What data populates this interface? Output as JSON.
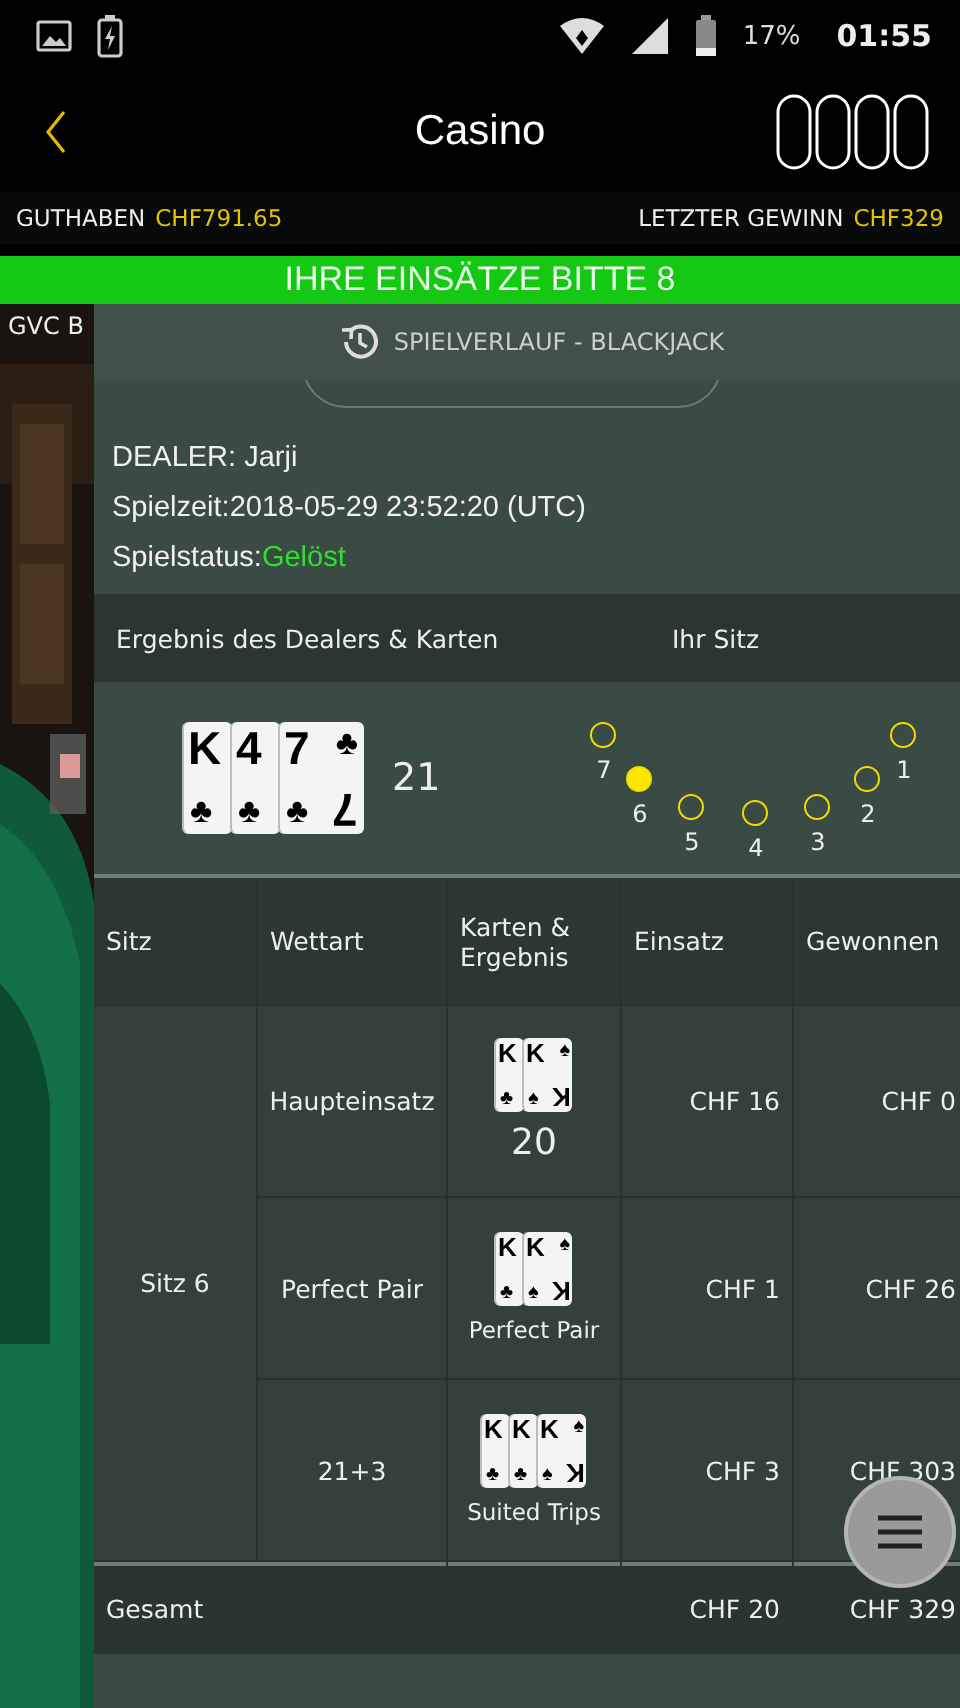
{
  "status_bar": {
    "battery_percent": "17%",
    "time": "01:55"
  },
  "header": {
    "title": "Casino"
  },
  "balance_bar": {
    "balance_label": "GUTHABEN",
    "balance_value": "CHF791.65",
    "last_win_label": "LETZTER GEWINN",
    "last_win_value": "CHF329"
  },
  "banner": {
    "text": "IHRE EINSÄTZE BITTE 8"
  },
  "background": {
    "table_label": "GVC B"
  },
  "history": {
    "title": "SPIELVERLAUF - BLACKJACK",
    "dealer": "DEALER: Jarji",
    "time": "Spielzeit:2018-05-29 23:52:20 (UTC)",
    "status_label": "Spielstatus:",
    "status_value": "Gelöst",
    "section_headers": [
      "Ergebnis des Dealers & Karten",
      "Ihr Sitz"
    ],
    "dealer_cards": [
      {
        "rank": "K",
        "suit": "♣"
      },
      {
        "rank": "4",
        "suit": "♣"
      },
      {
        "rank": "7",
        "suit": "♣",
        "corner_suit": "♣",
        "corner_rank": "7"
      }
    ],
    "dealer_total": "21",
    "seats": [
      {
        "label": "7",
        "selected": false
      },
      {
        "label": "6",
        "selected": true
      },
      {
        "label": "5",
        "selected": false
      },
      {
        "label": "4",
        "selected": false
      },
      {
        "label": "3",
        "selected": false
      },
      {
        "label": "2",
        "selected": false
      },
      {
        "label": "1",
        "selected": false
      }
    ]
  },
  "table": {
    "columns": [
      "Sitz",
      "Wettart",
      "Karten & Ergebnis",
      "Einsatz",
      "Gewonnen"
    ],
    "seat": "Sitz 6",
    "rows": [
      {
        "bet_type": "Haupteinsatz",
        "cards": [
          {
            "rank": "K",
            "suit": "♣"
          },
          {
            "rank": "K",
            "suit": "♠",
            "corner_suit": "♠",
            "corner_rank": "K"
          }
        ],
        "hand_total": "20",
        "stake": "CHF 16",
        "won": "CHF 0"
      },
      {
        "bet_type": "Perfect Pair",
        "cards": [
          {
            "rank": "K",
            "suit": "♣"
          },
          {
            "rank": "K",
            "suit": "♠",
            "corner_suit": "♠",
            "corner_rank": "K"
          }
        ],
        "result": "Perfect Pair",
        "stake": "CHF 1",
        "won": "CHF 26"
      },
      {
        "bet_type": "21+3",
        "cards": [
          {
            "rank": "K",
            "suit": "♣"
          },
          {
            "rank": "K",
            "suit": "♣"
          },
          {
            "rank": "K",
            "suit": "♠",
            "corner_suit": "♠",
            "corner_rank": "K"
          }
        ],
        "result": "Suited Trips",
        "stake": "CHF 3",
        "won": "CHF 303"
      }
    ],
    "total_label": "Gesamt",
    "total_stake": "CHF 20",
    "total_won": "CHF 329"
  }
}
